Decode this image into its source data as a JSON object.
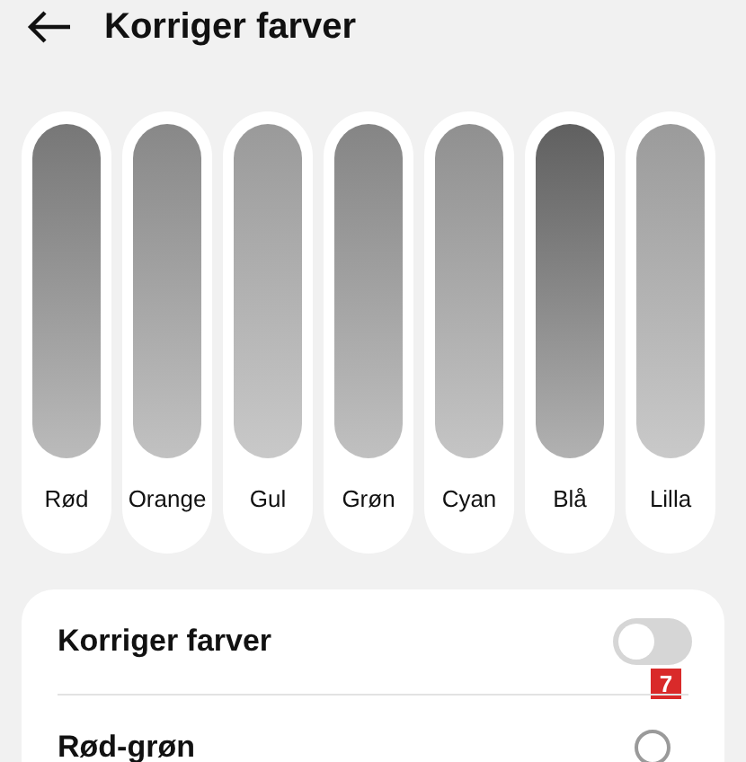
{
  "header": {
    "title": "Korriger farver"
  },
  "swatches": [
    {
      "label": "Rød",
      "color": "#777777"
    },
    {
      "label": "Orange",
      "color": "#888888"
    },
    {
      "label": "Gul",
      "color": "#9a9a9a"
    },
    {
      "label": "Grøn",
      "color": "#858585"
    },
    {
      "label": "Cyan",
      "color": "#909090"
    },
    {
      "label": "Blå",
      "color": "#606060"
    },
    {
      "label": "Lilla",
      "color": "#9b9b9b"
    }
  ],
  "settings": [
    {
      "kind": "toggle",
      "label": "Korriger farver",
      "on": false,
      "step_marker": "7"
    },
    {
      "kind": "radio",
      "label": "Rød-grøn",
      "selected": false
    }
  ]
}
